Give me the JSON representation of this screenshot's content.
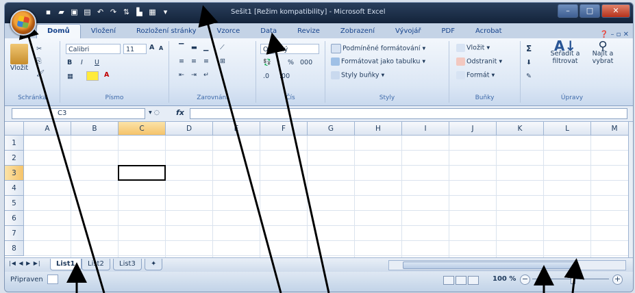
{
  "window": {
    "title": "Sešit1  [Režim kompatibility] - Microsoft Excel"
  },
  "quick_access": [
    "save-icon",
    "folder-icon",
    "floppy-icon",
    "print-preview-icon",
    "undo-icon",
    "redo-icon",
    "sort-icon",
    "chart-icon",
    "table-icon"
  ],
  "tabs": [
    {
      "label": "Domů",
      "active": true
    },
    {
      "label": "Vložení"
    },
    {
      "label": "Rozložení stránky"
    },
    {
      "label": "Vzorce"
    },
    {
      "label": "Data"
    },
    {
      "label": "Revize"
    },
    {
      "label": "Zobrazení"
    },
    {
      "label": "Vývojář"
    },
    {
      "label": "PDF"
    },
    {
      "label": "Acrobat"
    }
  ],
  "ribbon": {
    "clipboard": {
      "paste": "Vložit",
      "label": "Schránka"
    },
    "font": {
      "name": "Calibri",
      "size": "11",
      "bold": "B",
      "italic": "I",
      "underline": "U",
      "grow": "A",
      "shrink": "A",
      "label": "Písmo"
    },
    "alignment": {
      "label": "Zarovnání"
    },
    "number": {
      "format": "Obecný",
      "percent": "%",
      "thousands": "000",
      "label": "Čís"
    },
    "styles": {
      "conditional": "Podmíněné formátování",
      "as_table": "Formátovat jako tabulku",
      "cell_styles": "Styly buňky",
      "label": "Styly"
    },
    "cells": {
      "insert": "Vložit",
      "delete": "Odstranit",
      "format": "Formát",
      "label": "Buňky"
    },
    "editing": {
      "sigma": "Σ",
      "sort": "Seřadit a filtrovat",
      "find": "Najít a vybrat",
      "label": "Úpravy"
    }
  },
  "formula_bar": {
    "name_box": "C3",
    "fx": "fx",
    "formula": ""
  },
  "grid": {
    "columns": [
      "A",
      "B",
      "C",
      "D",
      "E",
      "F",
      "G",
      "H",
      "I",
      "J",
      "K",
      "L",
      "M"
    ],
    "rows": [
      "1",
      "2",
      "3",
      "4",
      "5",
      "6",
      "7",
      "8"
    ],
    "active_cell": "C3"
  },
  "sheets": [
    {
      "label": "List1",
      "active": true
    },
    {
      "label": "List2"
    },
    {
      "label": "List3"
    }
  ],
  "status": {
    "ready": "Připraven",
    "zoom": "100 %",
    "zoom_minus": "−",
    "zoom_plus": "+"
  }
}
